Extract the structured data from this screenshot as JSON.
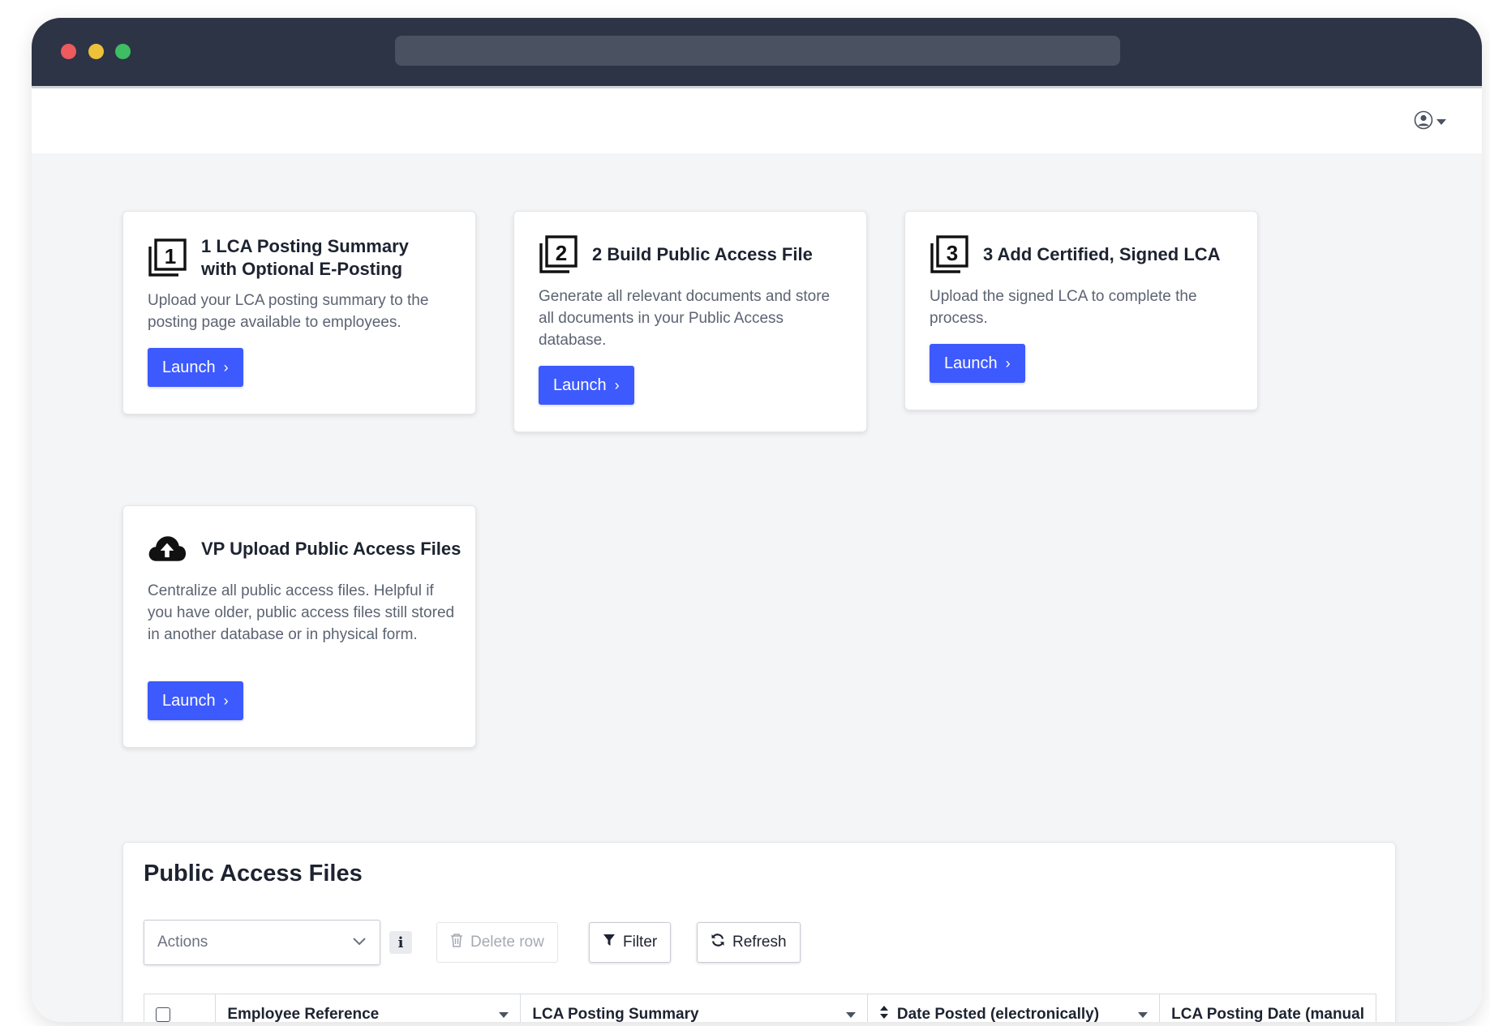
{
  "browser": {
    "url": ""
  },
  "header": {
    "user_menu_icon": "user-circle-icon"
  },
  "cards": [
    {
      "icon": "number-1-square-icon",
      "title": "1 LCA Posting Summary with Optional E-Posting",
      "description": "Upload your LCA posting summary to the posting page available to employees.",
      "button": "Launch"
    },
    {
      "icon": "number-2-square-icon",
      "title": "2 Build Public Access File",
      "description": "Generate all relevant documents and store all documents in your Public Access database.",
      "button": "Launch"
    },
    {
      "icon": "number-3-square-icon",
      "title": "3 Add Certified, Signed LCA",
      "description": "Upload the signed LCA to complete the process.",
      "button": "Launch"
    },
    {
      "icon": "cloud-upload-icon",
      "title": "VP Upload Public Access Files",
      "description": "Centralize all public access files. Helpful if you have older, public access files still stored in another database or in physical form.",
      "button": "Launch"
    }
  ],
  "panel": {
    "title": "Public Access Files",
    "actions_placeholder": "Actions",
    "info_label": "i",
    "delete_label": "Delete row",
    "filter_label": "Filter",
    "refresh_label": "Refresh",
    "columns": [
      "Employee Reference",
      "LCA Posting Summary",
      "Date Posted (electronically)",
      "LCA Posting Date (manual"
    ]
  },
  "colors": {
    "accent": "#3d5afe",
    "titlebar": "#2d3446",
    "background": "#f4f5f7"
  }
}
